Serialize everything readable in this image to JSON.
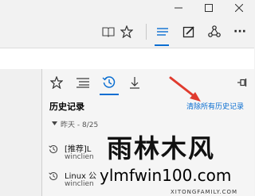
{
  "window": {
    "minimize_icon": "minimize-icon",
    "maximize_icon": "maximize-icon",
    "close_icon": "close-icon"
  },
  "toolbar": {
    "icons": [
      "reading-view-icon",
      "favorite-star-icon",
      "hub-icon",
      "web-note-icon",
      "share-icon",
      "more-icon"
    ],
    "more_label": "···"
  },
  "hub": {
    "tabs": [
      "favorites-star-icon",
      "reading-list-icon",
      "history-icon",
      "downloads-icon"
    ],
    "active_tab": "history",
    "title": "历史记录",
    "clear_link": "清除所有历史记录",
    "group_label": "昨天 - 8/25",
    "items": [
      {
        "title": "[推荐]L",
        "url": "winclien"
      },
      {
        "title": "Linux 公",
        "url": "winclien"
      }
    ]
  },
  "watermark": {
    "title": "雨林木风",
    "url": "ylmfwin100.com",
    "sub": "XITONGFAMILY.COM"
  },
  "colors": {
    "accent": "#0a6ed1",
    "arrow": "#e03b2e"
  }
}
